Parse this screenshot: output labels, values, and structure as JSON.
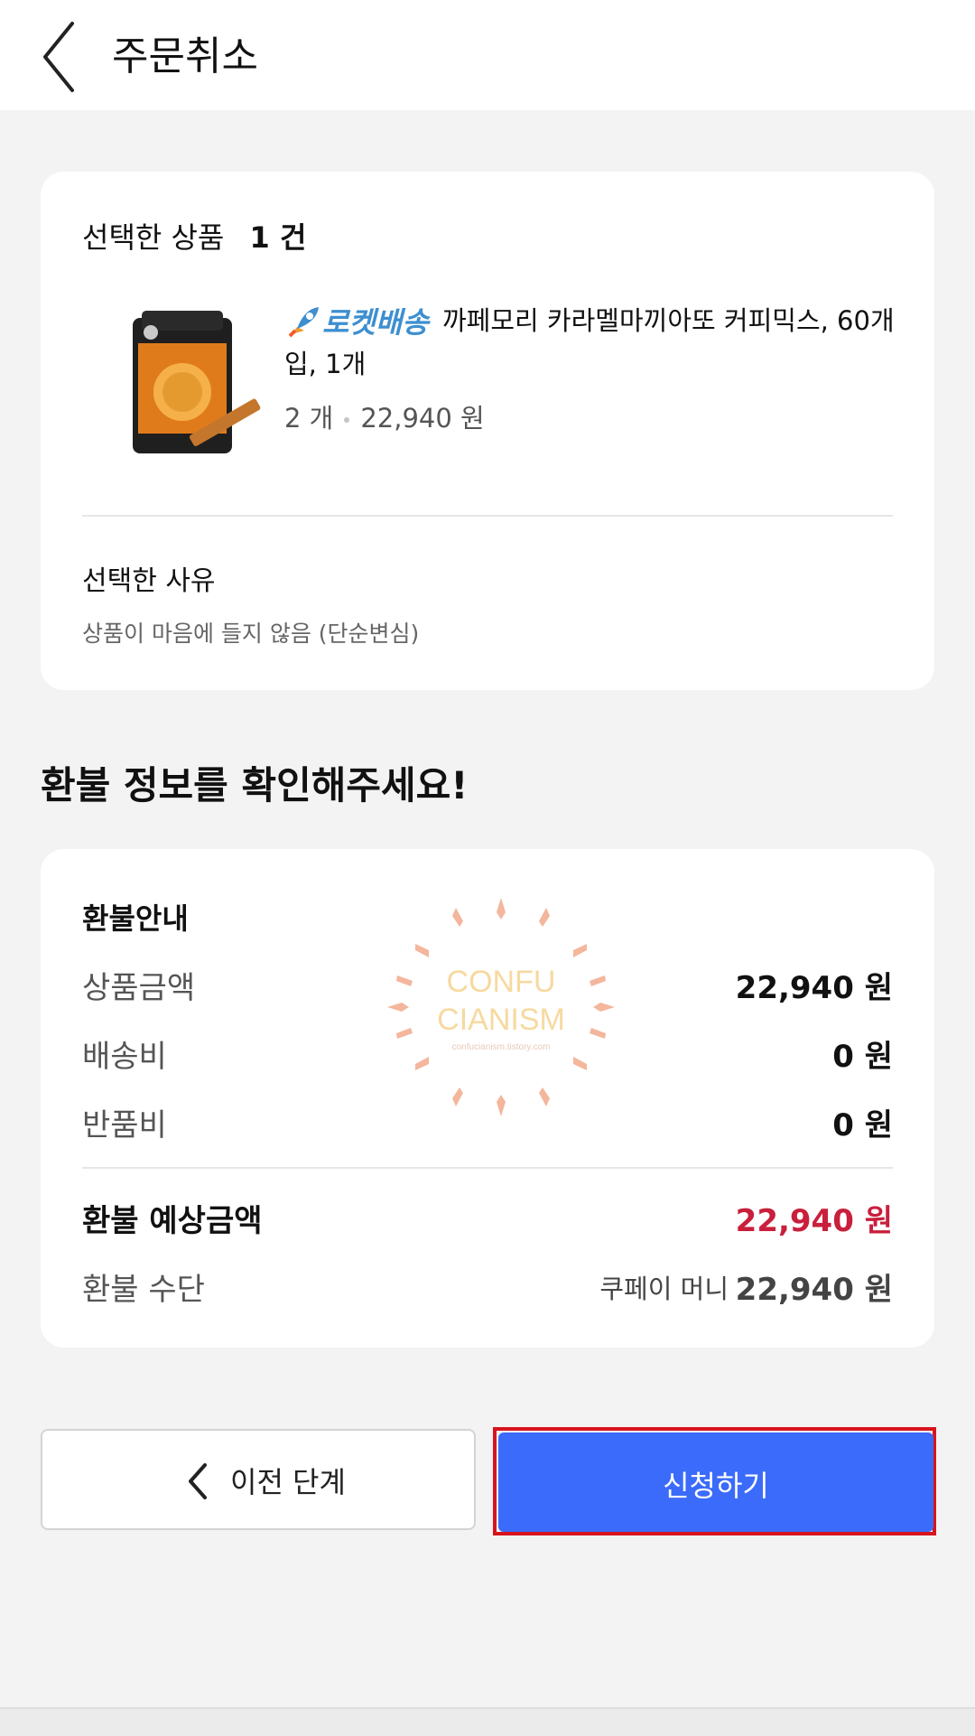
{
  "header": {
    "title": "주문취소"
  },
  "selected_product": {
    "label": "선택한 상품",
    "count": "1 건",
    "rocket_label": "로켓배송",
    "product_name": "까페모리 카라멜마끼아또 커피믹스, 60개입, 1개",
    "quantity": "2 개",
    "price": "22,940 원",
    "reason_label": "선택한 사유",
    "reason": "상품이 마음에 들지 않음 (단순변심)"
  },
  "refund": {
    "section_title": "환불 정보를 확인해주세요!",
    "guide_title": "환불안내",
    "rows": [
      {
        "label": "상품금액",
        "value": "22,940 원"
      },
      {
        "label": "배송비",
        "value": "0 원"
      },
      {
        "label": "반품비",
        "value": "0 원"
      }
    ],
    "expected_label": "환불 예상금액",
    "expected_value": "22,940 원",
    "method_label": "환불 수단",
    "method_name": "쿠페이 머니",
    "method_value": "22,940 원"
  },
  "watermark": {
    "line1": "CONFU",
    "line2": "CIANISM",
    "url": "confucianism.tistory.com"
  },
  "buttons": {
    "prev": "이전 단계",
    "submit": "신청하기"
  },
  "colors": {
    "accent_blue": "#3b6bfa",
    "refund_red": "#c91f3c",
    "rocket_blue": "#3d8fd0",
    "highlight_red": "#d7141e"
  }
}
